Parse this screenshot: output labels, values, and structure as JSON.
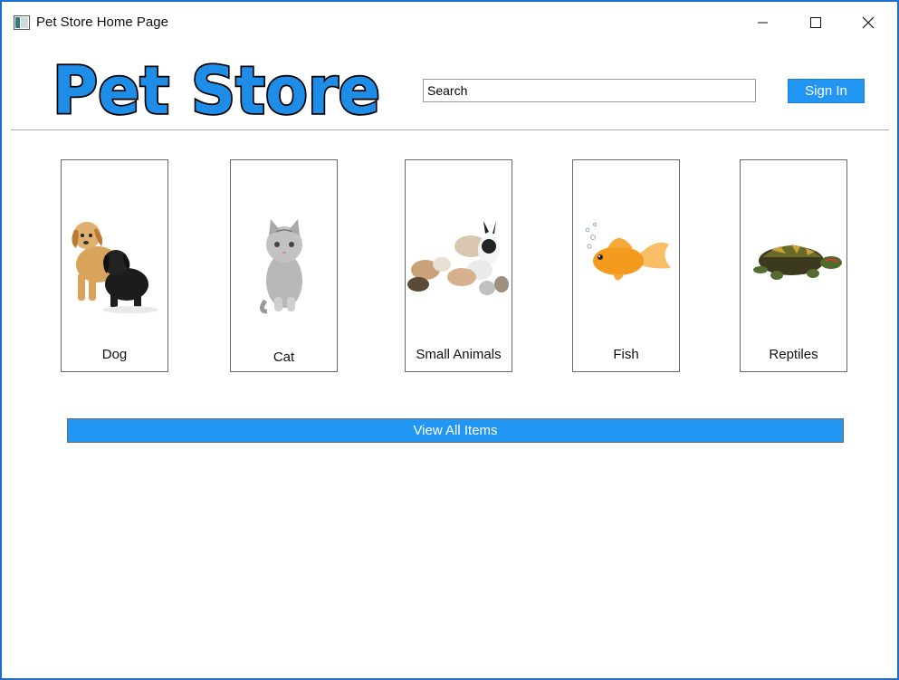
{
  "window": {
    "title": "Pet Store Home Page",
    "accent_color": "#1a6fd1"
  },
  "header": {
    "logo_text": "Pet Store",
    "search_value": "Search",
    "signin_label": "Sign In",
    "brand_color": "#2196f3"
  },
  "categories": [
    {
      "label": "Dog",
      "image": "dog-image"
    },
    {
      "label": "Cat",
      "image": "cat-image"
    },
    {
      "label": "Small Animals",
      "image": "small-animals-image"
    },
    {
      "label": "Fish",
      "image": "fish-image"
    },
    {
      "label": "Reptiles",
      "image": "reptiles-image"
    }
  ],
  "view_all_label": "View All Items"
}
